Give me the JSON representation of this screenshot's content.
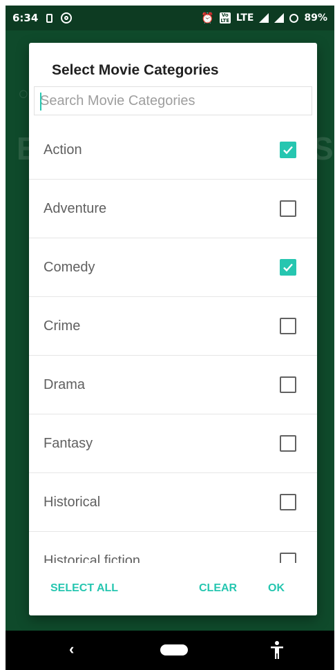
{
  "status_bar": {
    "time": "6:34",
    "network": "LTE",
    "volte": "Vo LTE",
    "battery": "89%"
  },
  "dialog": {
    "title": "Select Movie Categories",
    "search": {
      "placeholder": "Search Movie Categories",
      "value": ""
    },
    "items": [
      {
        "label": "Action",
        "checked": true
      },
      {
        "label": "Adventure",
        "checked": false
      },
      {
        "label": "Comedy",
        "checked": true
      },
      {
        "label": "Crime",
        "checked": false
      },
      {
        "label": "Drama",
        "checked": false
      },
      {
        "label": "Fantasy",
        "checked": false
      },
      {
        "label": "Historical",
        "checked": false
      },
      {
        "label": "Historical fiction",
        "checked": false
      }
    ],
    "actions": {
      "select_all": "SELECT ALL",
      "clear": "CLEAR",
      "ok": "OK"
    }
  },
  "colors": {
    "accent": "#26c6b0",
    "background": "#0f4a2b",
    "status_bar": "#0d3b22"
  },
  "icons": {
    "sim": "sim-card-icon",
    "data": "data-saver-icon",
    "alarm": "alarm-icon",
    "volte": "volte-icon",
    "signal": "signal-icon",
    "battery": "battery-saver-icon",
    "back": "back-icon",
    "home": "home-pill-icon",
    "accessibility": "accessibility-icon"
  }
}
